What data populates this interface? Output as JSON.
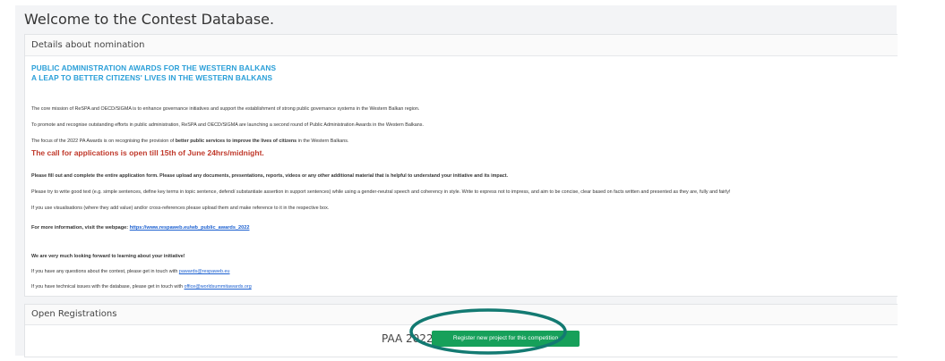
{
  "page": {
    "welcome_title": "Welcome to the Contest Database."
  },
  "details": {
    "header": "Details about nomination",
    "title_line1": "PUBLIC ADMINISTRATION AWARDS FOR THE WESTERN BALKANS",
    "title_line2": "A LEAP TO BETTER CITIZENS' LIVES IN THE WESTERN BALKANS",
    "p1": "The core mission of ReSPA and OECD/SIGMA is to enhance governance initiatives and support the establishment of strong public governance systems in the Western Balkan region.",
    "p2": "To promote and recognise outstanding efforts in public administration, ReSPA and OECD/SIGMA are launching a second round of Public Administration Awards in the Western Balkans.",
    "p3_before": "The focus of the 2022 PA Awards is on recognising the provision of ",
    "p3_bold": "better public services to improve the lives of citizens",
    "p3_after": " in the Western Balkans.",
    "call": "The call for applications is open till 15th of June 24hrs/midnight.",
    "p4": "Please fill out and complete the entire application form. Please upload any documents, presentations, reports, videos or any other additional material that is helpful to understand your initiative and its impact.",
    "p5": "Please try to write good text (e.g. simple sentences, define key terms in topic sentence, defend/ substantiate assertion in support sentences) while using a gender-neutral speech and coherency in style. Write to express not to impress, and aim to be concise, clear based on facts written and presented as they are, fully and fairly!",
    "p6": "If you use visualisations (where they add value) and/or cross-references please upload them and make reference to it in the respective box.",
    "more_info_label": "For more information, visit the webpage: ",
    "more_info_link": "https://www.respaweb.eu/wb_public_awards_2022",
    "looking_forward": "We are very much looking forward to learning about your initiative!",
    "questions_text": "If you have any questions about the contest, please get in touch with ",
    "questions_email": "pawards@respaweb.eu",
    "technical_text": "If you have technical issues with the database, please get in touch with ",
    "technical_email": "office@worldsummitawards.org"
  },
  "open_registrations": {
    "header": "Open Registrations",
    "competition_name": "PAA 2022",
    "register_button": "Register new project for this competition"
  },
  "colors": {
    "highlight_ring": "#137a72",
    "button": "#16a05a",
    "title_blue": "#2a9fd8",
    "call_red": "#c0392b"
  }
}
